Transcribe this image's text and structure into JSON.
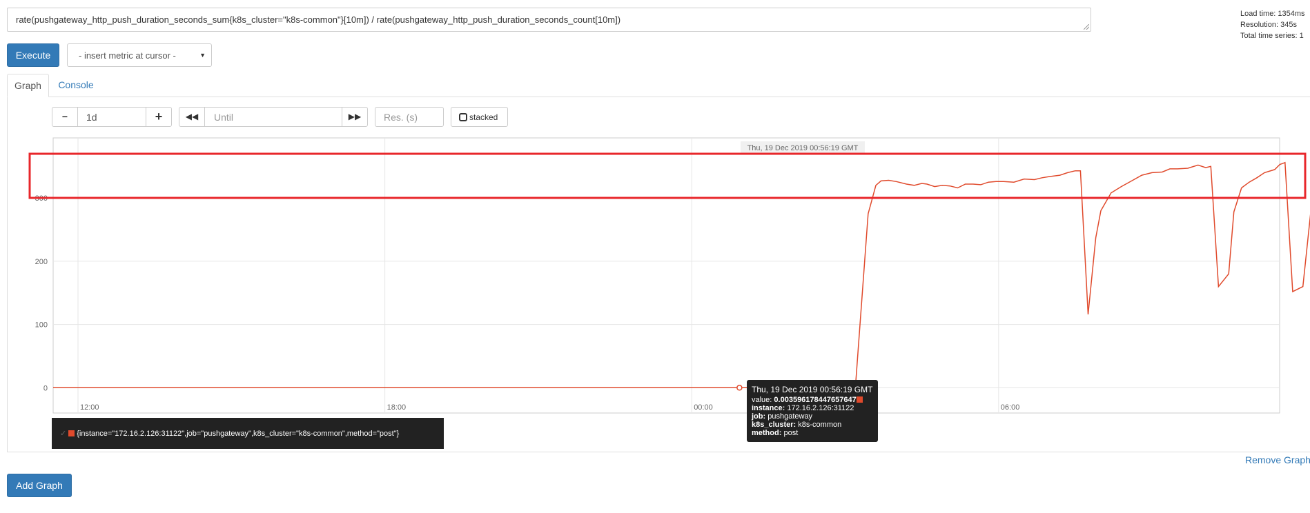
{
  "expression": "rate(pushgateway_http_push_duration_seconds_sum{k8s_cluster=\"k8s-common\"}[10m]) / rate(pushgateway_http_push_duration_seconds_count[10m])",
  "stats": {
    "load_time": "Load time: 1354ms",
    "resolution": "Resolution: 345s",
    "total_series": "Total time series: 1"
  },
  "toolbar": {
    "execute_label": "Execute",
    "insert_metric_label": "- insert metric at cursor -"
  },
  "tabs": {
    "graph": "Graph",
    "console": "Console"
  },
  "controls": {
    "range_minus": "−",
    "range_value": "1d",
    "range_plus": "+",
    "until_placeholder": "Until",
    "resolution_placeholder": "Res. (s)",
    "stacked_label": "stacked"
  },
  "chart_data": {
    "type": "line",
    "header_label": "Thu, 19 Dec 2019 00:56:19 GMT",
    "x_tick_labels": [
      "12:00",
      "18:00",
      "00:00",
      "06:00"
    ],
    "y_tick_labels": [
      "0",
      "100",
      "200",
      "300"
    ],
    "ylim": [
      -40,
      395
    ],
    "grid": true,
    "series": [
      {
        "name": "{instance=\"172.16.2.126:31122\",job=\"pushgateway\",k8s_cluster=\"k8s-common\",method=\"post\"}",
        "color": "#e04a2c",
        "hours_since_12": [
          -0.5,
          15.2,
          15.45,
          15.6,
          15.7,
          15.85,
          16.0,
          16.2,
          16.35,
          16.5,
          16.6,
          16.75,
          16.9,
          17.05,
          17.2,
          17.35,
          17.5,
          17.65,
          17.8,
          17.95,
          18.1,
          18.3,
          18.5,
          18.7,
          18.85,
          19.0,
          19.2,
          19.35,
          19.5,
          19.6,
          19.75,
          19.9,
          20.0,
          20.2,
          20.4,
          20.6,
          20.8,
          21.0,
          21.2,
          21.35,
          21.5,
          21.7,
          21.9,
          22.05,
          22.15,
          22.3,
          22.5,
          22.6,
          22.75,
          22.9,
          23.05,
          23.2,
          23.4,
          23.5,
          23.6,
          23.75,
          23.95,
          24.1,
          24.3,
          24.45,
          24.6,
          24.75,
          24.85,
          25.0,
          25.2,
          25.4,
          25.55,
          25.7,
          25.85,
          26.0,
          26.2,
          26.4,
          26.6,
          26.8,
          27.0
        ],
        "values": [
          0,
          0,
          275,
          320,
          327,
          328,
          326,
          322,
          320,
          323,
          322,
          318,
          320,
          319,
          316,
          322,
          322,
          321,
          325,
          326,
          326,
          325,
          330,
          329,
          332,
          334,
          336,
          340,
          343,
          343,
          116,
          237,
          280,
          308,
          318,
          327,
          336,
          340,
          341,
          346,
          346,
          347,
          352,
          348,
          350,
          160,
          180,
          278,
          316,
          325,
          332,
          340,
          345,
          353,
          356,
          152,
          160,
          275,
          320,
          335,
          340,
          350,
          353,
          353,
          358,
          360,
          362,
          363,
          364,
          365,
          366,
          366,
          367,
          368,
          369
        ]
      }
    ],
    "hover": {
      "time": "Thu, 19 Dec 2019 00:56:19 GMT",
      "value_label": "value:",
      "value": "0.003596178447657647",
      "instance_label": "instance:",
      "instance": "172.16.2.126:31122",
      "job_label": "job:",
      "job": "pushgateway",
      "cluster_label": "k8s_cluster:",
      "cluster": "k8s-common",
      "method_label": "method:",
      "method": "post"
    }
  },
  "legend": {
    "series_label": "{instance=\"172.16.2.126:31122\",job=\"pushgateway\",k8s_cluster=\"k8s-common\",method=\"post\"}"
  },
  "footer": {
    "remove_graph": "Remove Graph",
    "add_graph": "Add Graph"
  },
  "colors": {
    "accent": "#337ab7",
    "series": "#e04a2c",
    "annotation": "#e8272b"
  }
}
